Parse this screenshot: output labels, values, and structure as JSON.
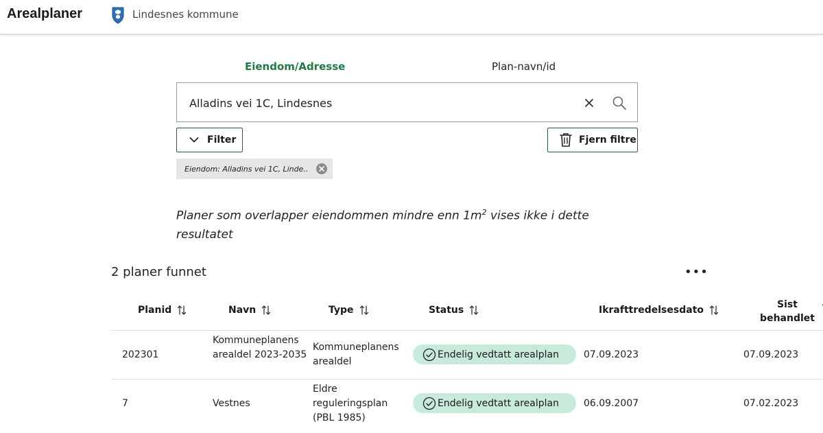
{
  "header": {
    "app_title": "Arealplaner",
    "kommune": "Lindesnes kommune"
  },
  "tabs": [
    {
      "label": "Eiendom/Adresse",
      "active": true
    },
    {
      "label": "Plan-navn/id",
      "active": false
    }
  ],
  "search": {
    "value": "Alladins vei 1C, Lindesnes"
  },
  "filter_button": {
    "label": "Filter"
  },
  "clear_filters_button": {
    "label": "Fjern filtre"
  },
  "active_filter_chip": {
    "label": "Eiendom: Alladins vei 1C, Linde.."
  },
  "notice": {
    "before": "Planer som overlapper eiendommen mindre enn 1m",
    "sup": "2",
    "after": " vises ikke i dette resultatet"
  },
  "results": {
    "count_label": "2 planer funnet",
    "columns": [
      "Planid",
      "Navn",
      "Type",
      "Status",
      "Ikrafttredelsesdato",
      "Sist behandlet"
    ],
    "rows": [
      {
        "planid": "202301",
        "navn": "Kommuneplanens arealdel 2023-2035",
        "type": "Kommuneplanens arealdel",
        "status": "Endelig vedtatt arealplan",
        "ikraft": "07.09.2023",
        "sist": "07.09.2023"
      },
      {
        "planid": "7",
        "navn": "Vestnes",
        "type": "Eldre reguleringsplan (PBL 1985)",
        "status": "Endelig vedtatt arealplan",
        "ikraft": "06.09.2007",
        "sist": "07.02.2023"
      }
    ]
  },
  "colors": {
    "accent_green": "#1e7a46",
    "button_border": "#1e5e3c",
    "status_badge_bg": "#c7eadb"
  }
}
